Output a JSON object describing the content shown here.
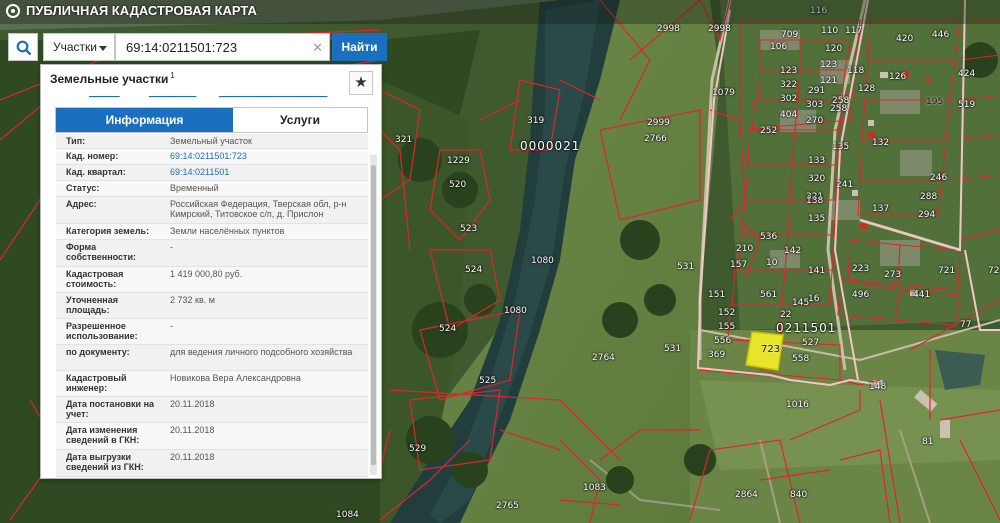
{
  "header": {
    "title": "ПУБЛИЧНАЯ КАДАСТРОВАЯ КАРТА"
  },
  "search": {
    "type_label": "Участки",
    "query": "69:14:0211501:723",
    "submit_label": "Найти",
    "clear_glyph": "✕"
  },
  "panel": {
    "title": "Земельные участки",
    "title_sup": "1",
    "star_glyph": "★",
    "tabs": [
      "Информация",
      "Услуги"
    ],
    "rows": [
      {
        "label": "Тип:",
        "value": "Земельный участок"
      },
      {
        "label": "Кад. номер:",
        "value": "69:14:0211501:723"
      },
      {
        "label": "Кад. квартал:",
        "value": "69:14:0211501"
      },
      {
        "label": "Статус:",
        "value": "Временный"
      },
      {
        "label": "Адрес:",
        "value": "Российская Федерация, Тверская обл, р-н Кимрский, Титовское с/п, д. Прислон"
      },
      {
        "label": "Категория земель:",
        "value": "Земли населённых пунктов"
      },
      {
        "label": "Форма собственности:",
        "value": "-"
      },
      {
        "label": "Кадастровая стоимость:",
        "value": "1 419 000,80 руб."
      },
      {
        "label": "Уточненная площадь:",
        "value": "2 732 кв. м"
      },
      {
        "label": "Разрешенное использование:",
        "value": "-"
      },
      {
        "label": "по документу:",
        "value": "для ведения личного подсобного хозяйства"
      },
      {
        "label": "Кадастровый инженер:",
        "value": "Новикова Вера Александровна"
      },
      {
        "label": "Дата постановки на учет:",
        "value": "20.11.2018"
      },
      {
        "label": "Дата изменения сведений в ГКН:",
        "value": "20.11.2018"
      },
      {
        "label": "Дата выгрузки сведений из ГКН:",
        "value": "20.11.2018"
      }
    ]
  },
  "map": {
    "quarter_labels": [
      "0000021",
      "0211501"
    ],
    "highlighted_parcel": "723",
    "parcel_labels": [
      "2998",
      "2998",
      "1079",
      "116",
      "709",
      "110",
      "117",
      "106",
      "120",
      "123",
      "420",
      "446",
      "123",
      "118",
      "126",
      "424",
      "121",
      "128",
      "322",
      "291",
      "258",
      "195",
      "519",
      "302",
      "303",
      "258",
      "404",
      "270",
      "132",
      "133",
      "252",
      "135",
      "246",
      "320",
      "241",
      "288",
      "321",
      "294",
      "138",
      "135",
      "536",
      "137",
      "142",
      "210",
      "157",
      "10",
      "141",
      "223",
      "273",
      "721",
      "531",
      "1080",
      "2766",
      "2999",
      "1080",
      "319",
      "321",
      "1229",
      "520",
      "523",
      "524",
      "524",
      "525",
      "529",
      "1083",
      "1084",
      "2765",
      "2764",
      "840",
      "2864",
      "81",
      "148",
      "558",
      "527",
      "145",
      "561",
      "151",
      "152",
      "155",
      "556",
      "369",
      "531",
      "1016",
      "496",
      "16",
      "22",
      "77",
      "441",
      "721"
    ],
    "colors": {
      "accent": "#1a6fbf",
      "parcel_border": "#e0242e",
      "highlight": "#e7e52a"
    }
  }
}
